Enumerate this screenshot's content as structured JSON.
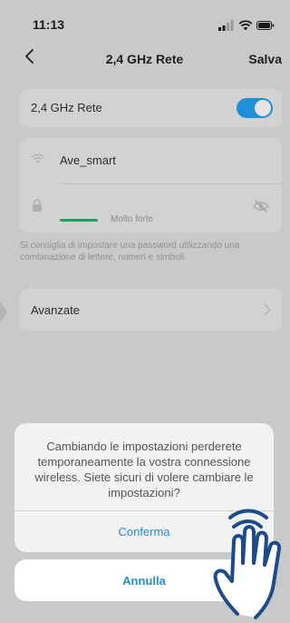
{
  "status_bar": {
    "time": "11:13",
    "icons": [
      "signal-icon",
      "wifi-icon",
      "battery-icon"
    ]
  },
  "nav": {
    "back_icon": "chevron-left-icon",
    "title": "2,4 GHz Rete",
    "save_label": "Salva"
  },
  "network_toggle": {
    "label": "2,4 GHz Rete",
    "enabled": true,
    "accent_color": "#1f8fd6"
  },
  "wifi": {
    "ssid": "Ave_smart",
    "password_value": "",
    "strength_label": "Molto forte",
    "strength_color": "#1aa35b",
    "icons": [
      "wifi-icon",
      "lock-icon",
      "eye-off-icon"
    ]
  },
  "hint": "Si consiglia di impostare una password utilizzando una combinazione di lettere, numeri e simboli.",
  "advanced": {
    "label": "Avanzate",
    "icon": "chevron-right-icon"
  },
  "action_sheet": {
    "message": "Cambiando le impostazioni perderete temporaneamente la vostra connessione wireless. Siete sicuri di volere cambiare le impostazioni?",
    "confirm_label": "Conferma",
    "cancel_label": "Annulla"
  },
  "overlay_icon": "tap-hand-icon"
}
